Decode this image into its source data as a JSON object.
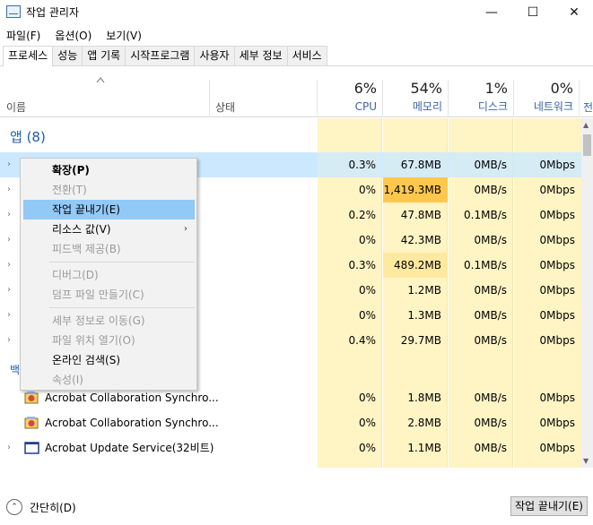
{
  "window": {
    "title": "작업 관리자",
    "minimize": "—",
    "maximize": "☐",
    "close": "✕"
  },
  "menu": [
    "파일(F)",
    "옵션(O)",
    "보기(V)"
  ],
  "tabs": [
    "프로세스",
    "성능",
    "앱 기록",
    "시작프로그램",
    "사용자",
    "세부 정보",
    "서비스"
  ],
  "header": {
    "name": "이름",
    "status": "상태",
    "cpu": {
      "pct": "6%",
      "label": "CPU"
    },
    "memory": {
      "pct": "54%",
      "label": "메모리"
    },
    "disk": {
      "pct": "1%",
      "label": "디스크"
    },
    "network": {
      "pct": "0%",
      "label": "네트워크"
    },
    "next": "전"
  },
  "group_apps": "앱 (8)",
  "group_bg_partial": "백",
  "rows": [
    {
      "cpu": "0.3%",
      "mem": "67.8MB",
      "disk": "0MB/s",
      "net": "0Mbps"
    },
    {
      "cpu": "0%",
      "mem": "1,419.3MB",
      "disk": "0MB/s",
      "net": "0Mbps"
    },
    {
      "cpu": "0.2%",
      "mem": "47.8MB",
      "disk": "0.1MB/s",
      "net": "0Mbps"
    },
    {
      "cpu": "0%",
      "mem": "42.3MB",
      "disk": "0MB/s",
      "net": "0Mbps"
    },
    {
      "cpu": "0.3%",
      "mem": "489.2MB",
      "disk": "0.1MB/s",
      "net": "0Mbps"
    },
    {
      "cpu": "0%",
      "mem": "1.2MB",
      "disk": "0MB/s",
      "net": "0Mbps"
    },
    {
      "cpu": "0%",
      "mem": "1.3MB",
      "disk": "0MB/s",
      "net": "0Mbps"
    },
    {
      "cpu": "0.4%",
      "mem": "29.7MB",
      "disk": "0MB/s",
      "net": "0Mbps"
    }
  ],
  "bg_rows": [
    {
      "name": "Acrobat Collaboration Synchro...",
      "cpu": "0%",
      "mem": "1.8MB",
      "disk": "0MB/s",
      "net": "0Mbps"
    },
    {
      "name": "Acrobat Collaboration Synchro...",
      "cpu": "0%",
      "mem": "2.8MB",
      "disk": "0MB/s",
      "net": "0Mbps"
    },
    {
      "name": "Acrobat Update Service(32비트)",
      "cpu": "0%",
      "mem": "1.1MB",
      "disk": "0MB/s",
      "net": "0Mbps"
    }
  ],
  "context_menu": {
    "expand": "확장(P)",
    "switch": "전환(T)",
    "end_task": "작업 끝내기(E)",
    "resource_values": "리소스 값(V)",
    "feedback": "피드백 제공(B)",
    "debug": "디버그(D)",
    "dump": "덤프 파일 만들기(C)",
    "details": "세부 정보로 이동(G)",
    "open_location": "파일 위치 열기(O)",
    "search_online": "온라인 검색(S)",
    "properties": "속성(I)"
  },
  "footer": {
    "collapse": "간단히(D)",
    "end_task": "작업 끝내기(E)"
  },
  "colors": {
    "accent_blue": "#1f5ca8",
    "heat_light": "#fff4c4",
    "heat_mid": "#ffe9a0",
    "heat_high": "#ffc84d",
    "row_selected": "#cce8ff"
  }
}
